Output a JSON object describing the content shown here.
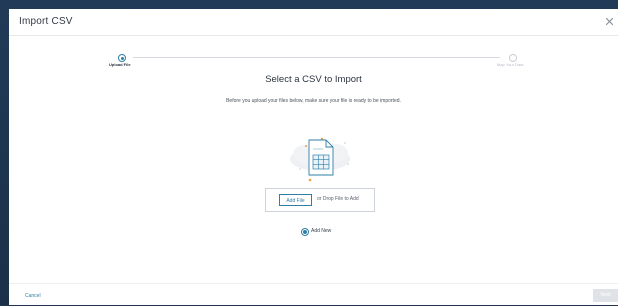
{
  "modal": {
    "title": "Import CSV"
  },
  "stepper": {
    "steps": [
      {
        "label": "Upload File",
        "state": "active"
      },
      {
        "label": "Map Your Data",
        "state": "pending"
      }
    ]
  },
  "main": {
    "heading": "Select a CSV to Import",
    "subtext": "Before you upload your files below, make sure your file is ready to be imported.",
    "add_file_label": "Add File",
    "drop_text": "or Drop File to Add",
    "radio_label": "Add New"
  },
  "footer": {
    "cancel_label": "Cancel",
    "next_label": "Next"
  },
  "colors": {
    "accent": "#2f7fa6",
    "backdrop": "#1f3550"
  }
}
